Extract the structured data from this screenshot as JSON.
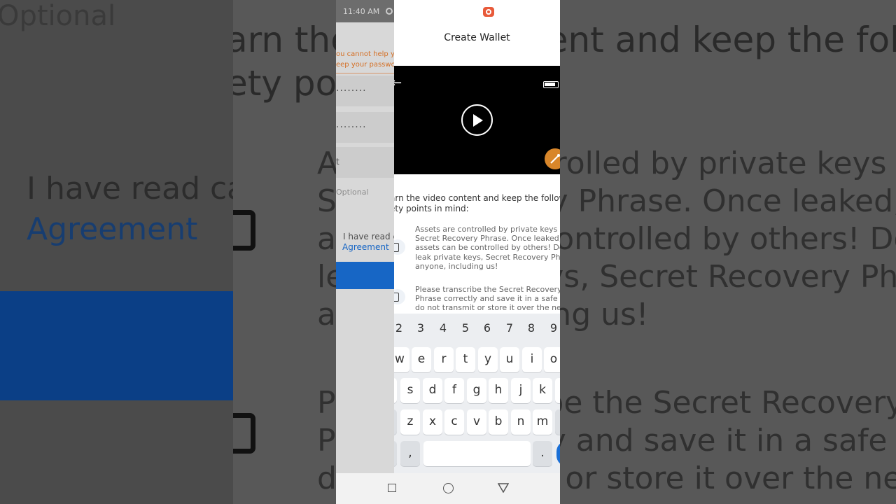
{
  "status_bar": {
    "time": "11:40 AM"
  },
  "background_form": {
    "notice_line1": "ou cannot help yo",
    "notice_line2": "eep your passwor",
    "password_mask": "........",
    "confirm_mask": "........",
    "hint_fragment": "t",
    "optional_placeholder": "Optional",
    "agreement_prefix": "I have read ca",
    "agreement_link": "Agreement"
  },
  "zoom_backdrop": {
    "optional": "Optional",
    "heading_line1": "arn the video content and keep the follow",
    "heading_line2": "ety points in mind:",
    "read_prefix": "I have read ca",
    "agreement": "Agreement",
    "point1_line1": "Assets are controlled by private keys and",
    "point1_line2": "Secret Recovery Phrase. Once leaked,",
    "point1_line3": "assets can be controlled by others! Do n",
    "point1_line4": "leak private keys, Secret Recovery Phras",
    "point1_line5": "anyone, including us!",
    "point2_line1": "Please transcribe the Secret Recovery",
    "point2_line2": "Phrase correctly and save it in a safe pla",
    "point2_line3": "do not transmit or store it over the netwo"
  },
  "sheet": {
    "title": "Create Wallet",
    "intro_line1": "arn the video content and keep the follow",
    "intro_line2": "ety points in mind:",
    "points": [
      {
        "line1": "Assets are controlled by private keys and",
        "line2": "Secret Recovery Phrase. Once leaked,",
        "line3": "assets can be controlled by others! Do n",
        "line4": "leak private keys, Secret Recovery Phras",
        "line5": "anyone, including us!"
      },
      {
        "line1": "Please transcribe the Secret Recovery",
        "line2": "Phrase correctly and save it in a safe pla",
        "line3": "do not transmit or store it over the netwo"
      }
    ]
  },
  "keyboard": {
    "numbers": [
      "2",
      "3",
      "4",
      "5",
      "6",
      "7",
      "8",
      "9"
    ],
    "row1": [
      "w",
      "e",
      "r",
      "t",
      "y",
      "u",
      "i",
      "o"
    ],
    "row2": [
      "s",
      "d",
      "f",
      "g",
      "h",
      "j",
      "k"
    ],
    "row3": [
      "z",
      "x",
      "c",
      "v",
      "b",
      "n",
      "m"
    ],
    "comma": ",",
    "period": "."
  },
  "icons": {
    "record": "record-icon",
    "back": "back-arrow-icon",
    "battery": "battery-icon",
    "play": "play-icon",
    "edit": "edit-fab-icon",
    "nav": [
      "recents-icon",
      "home-icon",
      "back-triangle-icon"
    ]
  },
  "colors": {
    "accent_blue": "#1a6fd6",
    "warning_orange": "#e77a2a",
    "record_red": "#e85a3a",
    "fab_orange": "#d8862a"
  }
}
